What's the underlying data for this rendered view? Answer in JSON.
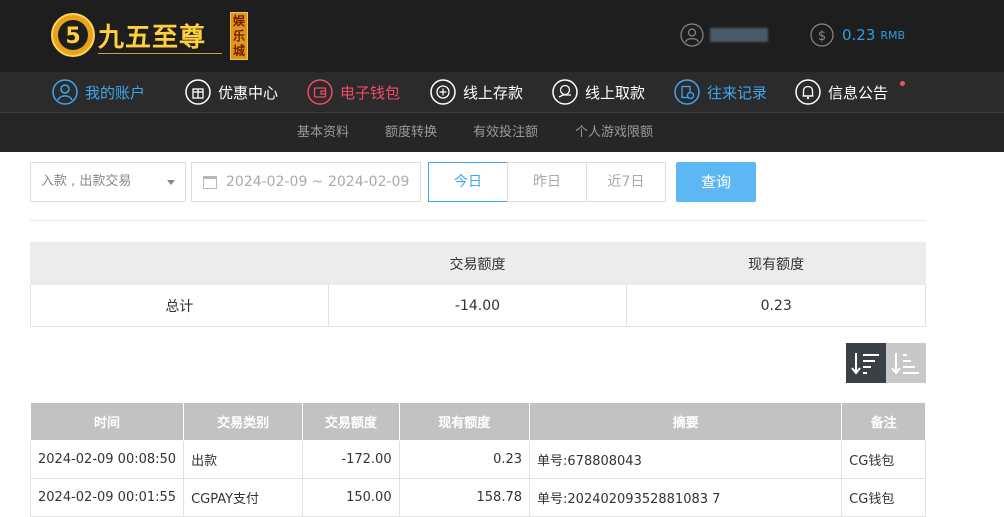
{
  "header": {
    "logo_text": "九五至尊",
    "logo_sub": "娱乐城",
    "balance_value": "0.23",
    "balance_unit": "RMB"
  },
  "nav": {
    "items": [
      {
        "label": "我的账户",
        "icon": "user-circle-icon"
      },
      {
        "label": "优惠中心",
        "icon": "gift-icon"
      },
      {
        "label": "电子钱包",
        "icon": "wallet-icon"
      },
      {
        "label": "线上存款",
        "icon": "deposit-icon"
      },
      {
        "label": "线上取款",
        "icon": "withdraw-icon"
      },
      {
        "label": "往来记录",
        "icon": "record-icon"
      },
      {
        "label": "信息公告",
        "icon": "bell-icon"
      }
    ]
  },
  "subnav": {
    "items": [
      "基本资料",
      "额度转换",
      "有效投注额",
      "个人游戏限额"
    ]
  },
  "filter": {
    "type_value": "入款 , 出款交易",
    "date_range": "2024-02-09 ~ 2024-02-09",
    "range_buttons": [
      "今日",
      "昨日",
      "近7日"
    ],
    "query_label": "查询"
  },
  "summary": {
    "headers": [
      "",
      "交易额度",
      "现有额度"
    ],
    "row": [
      "总计",
      "-14.00",
      "0.23"
    ]
  },
  "records": {
    "headers": [
      "时间",
      "交易类别",
      "交易额度",
      "现有额度",
      "摘要",
      "备注"
    ],
    "rows": [
      [
        "2024-02-09 00:08:50",
        "出款",
        "-172.00",
        "0.23",
        "单号:678808043",
        "CG钱包"
      ],
      [
        "2024-02-09 00:01:55",
        "CGPAY支付",
        "150.00",
        "158.78",
        "单号:20240209352881083 7",
        "CG钱包"
      ]
    ]
  }
}
